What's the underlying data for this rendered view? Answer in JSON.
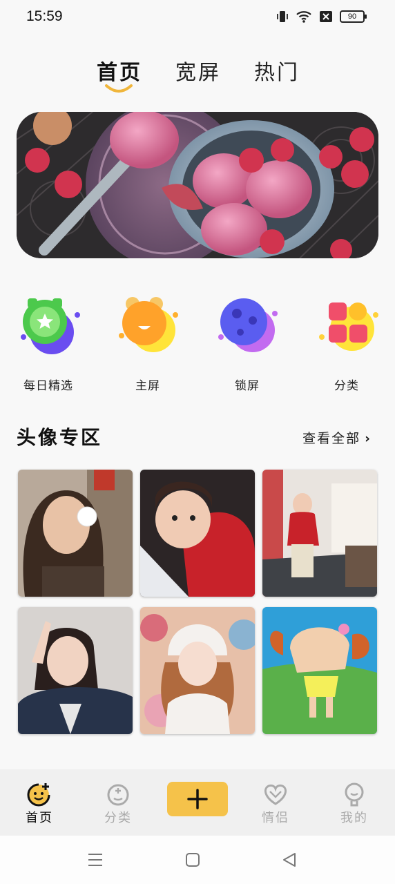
{
  "status_bar": {
    "time": "15:59",
    "battery": "90",
    "icons": [
      "vibrate-icon",
      "wifi-icon",
      "no-sim-icon",
      "battery-icon"
    ]
  },
  "top_tabs": [
    {
      "label": "首页",
      "active": true
    },
    {
      "label": "宽屏",
      "active": false
    },
    {
      "label": "热门",
      "active": false
    }
  ],
  "banner": {
    "image": "ice-cream-raspberry-banner"
  },
  "categories": [
    {
      "label": "每日精选",
      "icon": "daily-pick-icon"
    },
    {
      "label": "主屏",
      "icon": "home-screen-icon"
    },
    {
      "label": "锁屏",
      "icon": "lock-screen-icon"
    },
    {
      "label": "分类",
      "icon": "category-grid-icon"
    }
  ],
  "section": {
    "title": "头像专区",
    "see_all": "查看全部"
  },
  "avatars": [
    {
      "subject": "girl-blowing-bubble"
    },
    {
      "subject": "toddler-red-sweater"
    },
    {
      "subject": "toddler-in-room"
    },
    {
      "subject": "woman-peace-sign"
    },
    {
      "subject": "woman-white-beanie"
    },
    {
      "subject": "cartoon-shinchan"
    }
  ],
  "bottom_nav": [
    {
      "label": "首页",
      "icon": "home-face-icon",
      "active": true
    },
    {
      "label": "分类",
      "icon": "category-face-icon",
      "active": false
    },
    {
      "label": "",
      "icon": "plus-icon",
      "active": false
    },
    {
      "label": "情侣",
      "icon": "couple-heart-icon",
      "active": false
    },
    {
      "label": "我的",
      "icon": "profile-icon",
      "active": false
    }
  ],
  "colors": {
    "accent": "#f5c24a",
    "underline": "#f0b63c",
    "inactive": "#aaaaaa"
  }
}
